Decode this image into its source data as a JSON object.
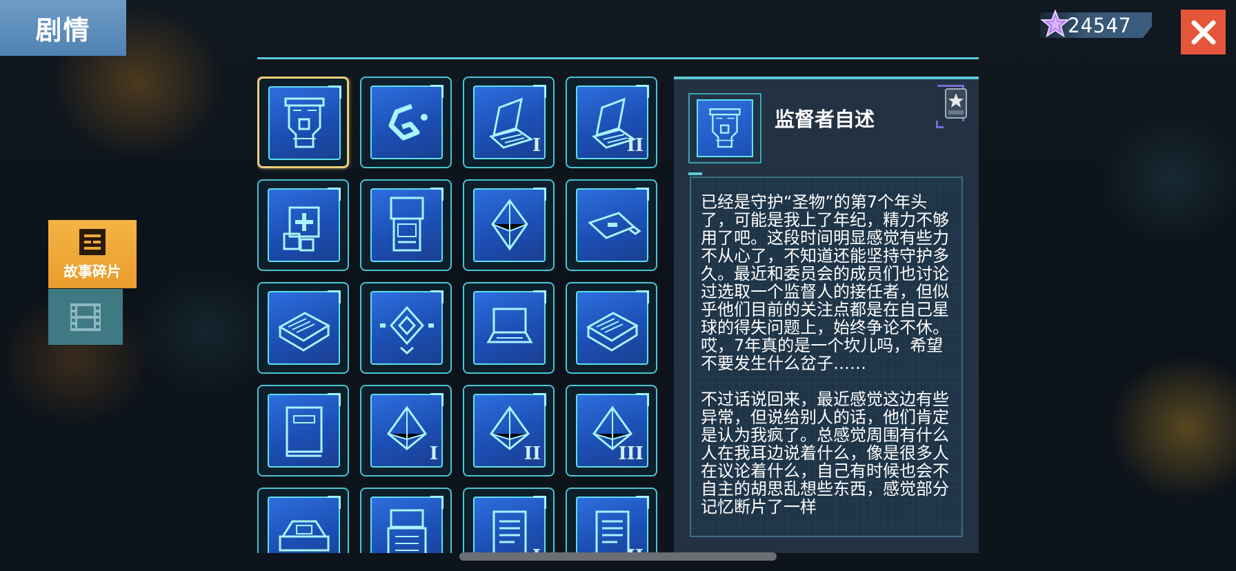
{
  "header": {
    "title": "剧情",
    "currency_value": "24547"
  },
  "side_tabs": [
    {
      "label": "故事碎片",
      "icon": "story-fragments-icon",
      "active": true
    },
    {
      "label": "",
      "icon": "film-icon",
      "active": false
    }
  ],
  "grid": {
    "items": [
      {
        "icon": "circuit-tower-icon",
        "roman": "",
        "selected": true
      },
      {
        "icon": "g-logo-icon",
        "roman": ""
      },
      {
        "icon": "laptop-icon",
        "roman": "I"
      },
      {
        "icon": "laptop-icon",
        "roman": "II"
      },
      {
        "icon": "medical-kit-icon",
        "roman": ""
      },
      {
        "icon": "terminal-device-icon",
        "roman": ""
      },
      {
        "icon": "crystal-icon",
        "roman": ""
      },
      {
        "icon": "usb-drive-icon",
        "roman": ""
      },
      {
        "icon": "book-icon",
        "roman": ""
      },
      {
        "icon": "diamond-emblem-icon",
        "roman": ""
      },
      {
        "icon": "laptop-open-icon",
        "roman": ""
      },
      {
        "icon": "book-icon",
        "roman": ""
      },
      {
        "icon": "notebook-icon",
        "roman": ""
      },
      {
        "icon": "pyramid-icon",
        "roman": "I"
      },
      {
        "icon": "pyramid-icon",
        "roman": "II"
      },
      {
        "icon": "pyramid-icon",
        "roman": "III"
      },
      {
        "icon": "console-icon",
        "roman": ""
      },
      {
        "icon": "robot-icon",
        "roman": ""
      },
      {
        "icon": "document-icon",
        "roman": "I"
      },
      {
        "icon": "document-icon",
        "roman": "II"
      }
    ]
  },
  "detail": {
    "title": "监督者自述",
    "paragraph_1": "已经是守护“圣物”的第7个年头了，可能是我上了年纪，精力不够用了吧。这段时间明显感觉有些力不从心了，不知道还能坚持守护多久。最近和委员会的成员们也讨论过选取一个监督人的接任者，但似乎他们目前的关注点都是在自己星球的得失问题上，始终争论不休。哎，7年真的是一个坎儿吗，希望不要发生什么岔子……",
    "paragraph_2": "不过话说回来，最近感觉这边有些异常，但说给别人的话，他们肯定是认为我疯了。总感觉周围有什么人在我耳边说着什么，像是很多人在议论着什么，自己有时候也会不自主的胡思乱想些东西，感觉部分记忆断片了一样"
  },
  "colors": {
    "accent": "#5bc8d6",
    "title_tab": "#5b8dbd",
    "active_tab": "#f0ab3a",
    "close": "#e5553a"
  }
}
